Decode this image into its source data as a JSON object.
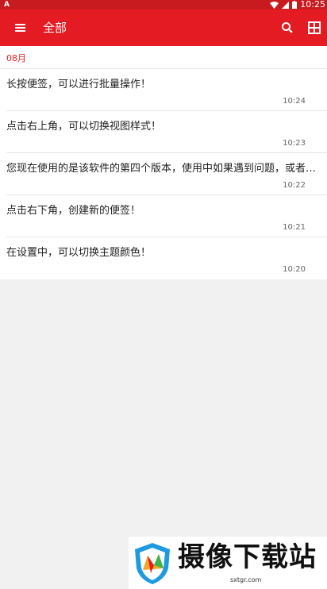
{
  "status_bar": {
    "time": "10:25"
  },
  "toolbar": {
    "menu_icon": "menu-icon",
    "title": "全部",
    "search_icon": "search-icon",
    "grid_icon": "grid-view-icon"
  },
  "list": {
    "month": "08月",
    "notes": [
      {
        "text": "长按便签，可以进行批量操作！",
        "time": "10:24"
      },
      {
        "text": "点击右上角，可以切换视图样式！",
        "time": "10:23"
      },
      {
        "text": "您现在使用的是该软件的第四个版本，使用中如果遇到问题，或者有...",
        "time": "10:22"
      },
      {
        "text": "点击右下角，创建新的便签！",
        "time": "10:21"
      },
      {
        "text": "在设置中，可以切换主题颜色！",
        "time": "10:20"
      }
    ]
  },
  "watermark": {
    "brand": "摄像下载站",
    "url": "sxtgr.com"
  }
}
